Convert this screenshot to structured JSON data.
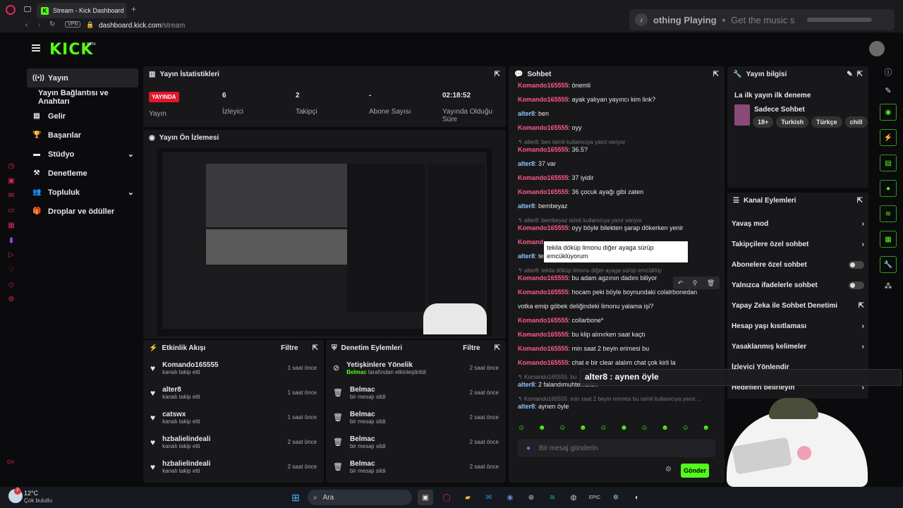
{
  "browser": {
    "tab_title": "Stream - Kick Dashboard",
    "url_host": "dashboard.kick.com",
    "url_path": "/stream",
    "vpn": "VPN",
    "media": {
      "now": "othing Playing",
      "sep": "•",
      "rest": "Get the music s"
    }
  },
  "brand": {
    "logo": "KICK",
    "beta": "BETA"
  },
  "sidebar": {
    "items": [
      {
        "label": "Yayın",
        "icon": "broadcast-icon"
      },
      {
        "label": "Yayın Bağlantısı ve Anahtarı",
        "icon": ""
      },
      {
        "label": "Gelir",
        "icon": "chart-icon"
      },
      {
        "label": "Başarılar",
        "icon": "trophy-icon"
      },
      {
        "label": "Stüdyo",
        "icon": "studio-icon"
      },
      {
        "label": "Denetleme",
        "icon": "hammer-icon"
      },
      {
        "label": "Topluluk",
        "icon": "people-icon"
      },
      {
        "label": "Droplar ve ödüller",
        "icon": "gift-icon"
      }
    ]
  },
  "stats": {
    "title": "Yayın İstatistikleri",
    "live_badge": "YAYINDA",
    "live_label": "Yayın",
    "items": [
      {
        "value": "6",
        "label": "İzleyici"
      },
      {
        "value": "2",
        "label": "Takipçi"
      },
      {
        "value": "-",
        "label": "Abone Sayısı"
      },
      {
        "value": "02:18:52",
        "label": "Yayında Olduğu Süre"
      }
    ]
  },
  "preview": {
    "title": "Yayın Ön İzlemesi"
  },
  "activity": {
    "title": "Etkinlik Akışı",
    "filter": "Filtre",
    "items": [
      {
        "name": "Komando165555",
        "sub": "kanalı takip etti",
        "time": "1 saat önce"
      },
      {
        "name": "alter8",
        "sub": "kanalı takip etti",
        "time": "1 saat önce"
      },
      {
        "name": "catswx",
        "sub": "kanalı takip etti",
        "time": "1 saat önce"
      },
      {
        "name": "hzbalielindeali",
        "sub": "kanalı takip etti",
        "time": "2 saat önce"
      },
      {
        "name": "hzbalielindeali",
        "sub": "kanalı takip etti",
        "time": "2 saat önce"
      }
    ]
  },
  "moderation": {
    "title": "Denetim Eylemleri",
    "filter": "Filtre",
    "items": [
      {
        "name": "Yetişkinlere Yönelik",
        "by": "Belmac",
        "sub": " tarafından etkinleştirildi",
        "time": "2 saat önce"
      },
      {
        "name": "Belmac",
        "by": "",
        "sub": "bir mesajı sildi",
        "time": "2 saat önce"
      },
      {
        "name": "Belmac",
        "by": "",
        "sub": "bir mesajı sildi",
        "time": "2 saat önce"
      },
      {
        "name": "Belmac",
        "by": "",
        "sub": "bir mesajı sildi",
        "time": "2 saat önce"
      },
      {
        "name": "Belmac",
        "by": "",
        "sub": "bir mesajı sildi",
        "time": "2 saat önce"
      }
    ]
  },
  "chat": {
    "title": "Sohbet",
    "placeholder": "Bir mesaj gönderin",
    "send": "Gönder",
    "tooltip": "tekila döküp limonu diğer ayaga sürüp emcüklüyorum",
    "overlay": "alter8 : aynen öyle",
    "messages": [
      {
        "user": "Komando165555",
        "cls": "u1",
        "text": ": önemli"
      },
      {
        "user": "Komando165555",
        "cls": "u1",
        "text": ": ayak yalıyan yayıncı kim link?"
      },
      {
        "user": "alter8",
        "cls": "u2",
        "text": ": ben"
      },
      {
        "user": "Komando165555",
        "cls": "u1",
        "text": ": oyy"
      },
      {
        "reply": "↰ alter8: ben isimli kullanıcıya yanıt veriyor",
        "user": "Komando165555",
        "cls": "u1",
        "text": ": 36.5?"
      },
      {
        "user": "alter8",
        "cls": "u2",
        "text": ": 37 var"
      },
      {
        "user": "Komando165555",
        "cls": "u1",
        "text": ": 37 iyidir"
      },
      {
        "user": "Komando165555",
        "cls": "u1",
        "text": ": 36 çocuk ayağı gibi zaten"
      },
      {
        "user": "alter8",
        "cls": "u2",
        "text": ": bembeyaz"
      },
      {
        "reply": "↰ alter8: bembeyaz isimli kullanıcıya yanıt veriyor",
        "user": "Komando165555",
        "cls": "u1",
        "text": ": oyy böyle bilekten şarap dökerken yenir"
      },
      {
        "user": "Komand",
        "cls": "u1",
        "text": ""
      },
      {
        "user": "alter8",
        "cls": "u2",
        "text": ": te"
      },
      {
        "reply": "↰ alter8: tekila döküp limonu diğer ayaga sürüp emcüklüy",
        "user": "Komando165555",
        "cls": "u1",
        "text": ": bu adam agzının dadını biliyor"
      },
      {
        "user": "Komando165555",
        "cls": "u1",
        "text": ": hocam peki böyle boynundaki colalrbonedan"
      },
      {
        "user": "",
        "cls": "",
        "text": "votka emip göbek deliğindeki limonu yalama işi?"
      },
      {
        "user": "Komando165555",
        "cls": "u1",
        "text": ": collarbone*"
      },
      {
        "user": "Komando165555",
        "cls": "u1",
        "text": ": bu klip alınırken saat kaçtı"
      },
      {
        "user": "Komando165555",
        "cls": "u1",
        "text": ": min saat 2 beyin erimesi bu"
      },
      {
        "user": "Komando165555",
        "cls": "u1",
        "text": ": chat e bir clear alalım chat çok kirli la"
      },
      {
        "reply": "↰ Komando165555: bu",
        "user": "alter8",
        "cls": "u2",
        "text": ": 2 falandımuhtemelen"
      },
      {
        "reply": "↰ Komando165555: min saat 2 beyin erimesi bu isimli kullanıcıya yanıt ...",
        "user": "alter8",
        "cls": "u2",
        "text": ": aynen öyle"
      }
    ]
  },
  "info": {
    "title": "Yayın bilgisi",
    "stream_title": "La ilk yayın ilk deneme",
    "category": "Sadece Sohbet",
    "tags": [
      "18+",
      "Turkish",
      "Türkçe",
      "chill"
    ]
  },
  "actions": {
    "title": "Kanal Eylemleri",
    "items": [
      {
        "label": "Yavaş mod",
        "ctl": "chevron"
      },
      {
        "label": "Takipçilere özel sohbet",
        "ctl": "chevron"
      },
      {
        "label": "Abonelere özel sohbet",
        "ctl": "toggle"
      },
      {
        "label": "Yalnızca ifadelerle sohbet",
        "ctl": "toggle"
      },
      {
        "label": "Yapay Zeka ile Sohbet Denetimi",
        "ctl": "external"
      },
      {
        "label": "Hesap yaşı kısıtlaması",
        "ctl": "chevron"
      },
      {
        "label": "Yasaklanmış kelimeler",
        "ctl": "chevron"
      },
      {
        "label": "İzleyici Yönlendir",
        "ctl": "none"
      },
      {
        "label": "Hedefleri belirleyin",
        "ctl": "chevron"
      }
    ]
  },
  "taskbar": {
    "temp": "12°C",
    "weather": "Çok bulutlu",
    "search": "Ara",
    "badge": "2"
  }
}
